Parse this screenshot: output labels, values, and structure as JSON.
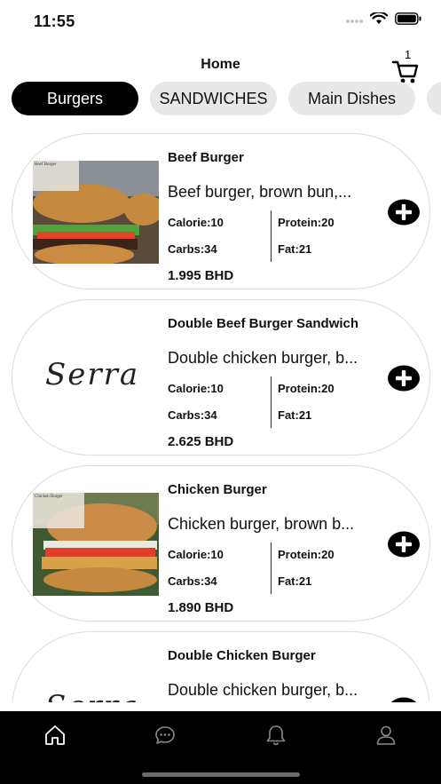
{
  "status": {
    "time": "11:55"
  },
  "header": {
    "title": "Home",
    "cart_count": "1"
  },
  "categories": [
    {
      "label": "Burgers",
      "active": true
    },
    {
      "label": "SANDWICHES",
      "active": false
    },
    {
      "label": "Main Dishes",
      "active": false
    }
  ],
  "items": [
    {
      "title": "Beef Burger",
      "description": "Beef burger, brown bun,...",
      "calorie": "Calorie:10",
      "protein": "Protein:20",
      "carbs": "Carbs:34",
      "fat": "Fat:21",
      "price": "1.995 BHD",
      "image_overlay": "Beef Burger"
    },
    {
      "title": "Double Beef Burger Sandwich",
      "description": "Double chicken burger, b...",
      "calorie": "Calorie:10",
      "protein": "Protein:20",
      "carbs": "Carbs:34",
      "fat": "Fat:21",
      "price": "2.625 BHD",
      "logo_text": "Serra"
    },
    {
      "title": "Chicken Burger",
      "description": "Chicken burger, brown b...",
      "calorie": "Calorie:10",
      "protein": "Protein:20",
      "carbs": "Carbs:34",
      "fat": "Fat:21",
      "price": "1.890 BHD",
      "image_overlay": "Chicken Burger"
    },
    {
      "title": "Double Chicken Burger",
      "description": "Double chicken burger, b...",
      "logo_text": "Serra"
    }
  ],
  "icons": {
    "add": "plus-circle-icon",
    "cart": "cart-icon",
    "tabbar": [
      "home-icon",
      "chat-icon",
      "bell-icon",
      "user-icon"
    ]
  },
  "colors": {
    "accent": "#000000",
    "tab_inactive": "#e8e8e8",
    "tabbar_bg": "#000000"
  }
}
